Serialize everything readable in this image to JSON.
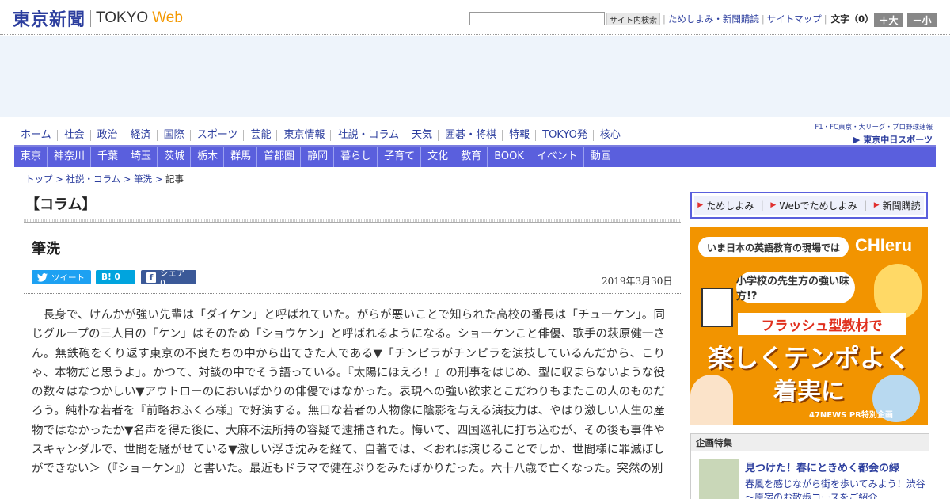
{
  "header": {
    "logo_jp": "東京新聞",
    "logo_en": "TOKYO",
    "logo_web": "Web",
    "search_button": "サイト内検索",
    "links": [
      "ためしよみ・新聞購読",
      "サイトマップ"
    ],
    "font_size_label": "文字（0）",
    "font_plus": "＋大",
    "font_minus": "－小"
  },
  "nav_main": [
    "ホーム",
    "社会",
    "政治",
    "経済",
    "国際",
    "スポーツ",
    "芸能",
    "東京情報",
    "社説・コラム",
    "天気",
    "囲碁・将棋",
    "特報",
    "TOKYO発",
    "核心"
  ],
  "sports_logo": {
    "top": "F1・FC東京・大リーグ・プロ野球速報",
    "main": "▶ 東京中日スポーツ"
  },
  "nav_region": [
    "東京",
    "神奈川",
    "千葉",
    "埼玉",
    "茨城",
    "栃木",
    "群馬",
    "首都圏",
    "静岡",
    "暮らし",
    "子育て",
    "文化",
    "教育",
    "BOOK",
    "イベント",
    "動画"
  ],
  "breadcrumb": {
    "items": [
      "トップ",
      "社説・コラム",
      "筆洗"
    ],
    "sep": " > ",
    "current": "記事"
  },
  "article": {
    "section": "【コラム】",
    "title": "筆洗",
    "share_tweet": "ツイート",
    "share_hatena": "B! 0",
    "share_fb": "シェア 0",
    "date": "2019年3月30日",
    "body": "長身で、けんかが強い先輩は「ダイケン」と呼ばれていた。がらが悪いことで知られた高校の番長は「チューケン」。同じグループの三人目の「ケン」はそのため「ショウケン」と呼ばれるようになる。ショーケンこと俳優、歌手の萩原健一さん。無鉄砲をくり返す東京の不良たちの中から出てきた人である▼「チンピラがチンピラを演技しているんだから、こりゃ、本物だと思うよ」。かつて、対談の中でそう語っている。『太陽にほえろ！』の刑事をはじめ、型に収まらないような役の数々はなつかしい▼アウトローのにおいばかりの俳優ではなかった。表現への強い欲求とこだわりもまたこの人のものだろう。純朴な若者を『前略おふくろ様』で好演する。無口な若者の人物像に陰影を与える演技力は、やはり激しい人生の産物ではなかったか▼名声を得た後に、大麻不法所持の容疑で逮捕された。悔いて、四国巡礼に打ち込むが、その後も事件やスキャンダルで、世間を騒がせている▼激しい浮き沈みを経て、自著では、＜おれは演じることでしか、世間様に罪滅ぼしができない＞（『ショーケン』）と書いた。最近もドラマで健在ぶりをみたばかりだった。六十八歳で亡くなった。突然の別"
  },
  "quicklinks": [
    "ためしよみ",
    "Webでためしよみ",
    "新聞購読"
  ],
  "banner": {
    "top": "いま日本の英語教育の現場では",
    "brand": "CHIeru",
    "sub": "小学校の先生方の強い味方!?",
    "flash": "フラッシュ型教材で",
    "big1": "楽しくテンポよく",
    "big2": "着実に",
    "pr": "47NEWS PR特別企画"
  },
  "special": {
    "head": "企画特集",
    "title": "見つけた！春にときめく都会の緑",
    "desc": "春風を感じながら街を歩いてみよう！渋谷～原宿のお散歩コースをご紹介"
  }
}
